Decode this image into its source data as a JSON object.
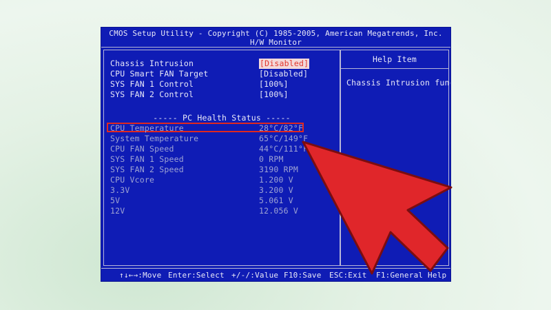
{
  "header": {
    "title": "CMOS Setup Utility - Copyright (C) 1985-2005, American Megatrends, Inc.",
    "subtitle": "H/W Monitor"
  },
  "settings": [
    {
      "label": "Chassis Intrusion",
      "value": "[Disabled]"
    },
    {
      "label": "CPU Smart FAN Target",
      "value": "[Disabled]"
    },
    {
      "label": "SYS FAN 1 Control",
      "value": "[100%]"
    },
    {
      "label": "SYS FAN 2 Control",
      "value": "[100%]"
    }
  ],
  "section_heading": "----- PC Health Status -----",
  "health": [
    {
      "label": "CPU Temperature",
      "value": "28°C/82°F"
    },
    {
      "label": "System Temperature",
      "value": "65°C/149°F"
    },
    {
      "label": "CPU FAN Speed",
      "value": "44°C/111°F"
    },
    {
      "label": "SYS FAN 1 Speed",
      "value": "0 RPM"
    },
    {
      "label": "SYS FAN 2 Speed",
      "value": "3190 RPM"
    },
    {
      "label": "CPU Vcore",
      "value": "1.200 V"
    },
    {
      "label": "3.3V",
      "value": "3.200 V"
    },
    {
      "label": "5V",
      "value": "5.061 V"
    },
    {
      "label": "12V",
      "value": "12.056 V"
    }
  ],
  "help": {
    "header": "Help Item",
    "text": "Chassis Intrusion func"
  },
  "status_bar": [
    {
      "key": "↑↓←→:Move"
    },
    {
      "key": "Enter:Select"
    },
    {
      "key": "+/-/:Value"
    },
    {
      "key": "F10:Save"
    },
    {
      "key": "ESC:Exit"
    },
    {
      "key": "F1:General Help"
    }
  ],
  "colors": {
    "bios_background": "#0f1cb5",
    "highlight_red": "#e0281f",
    "arrow_red": "#e0262a"
  },
  "overlay_icon": "red-arrow-pointer-icon"
}
